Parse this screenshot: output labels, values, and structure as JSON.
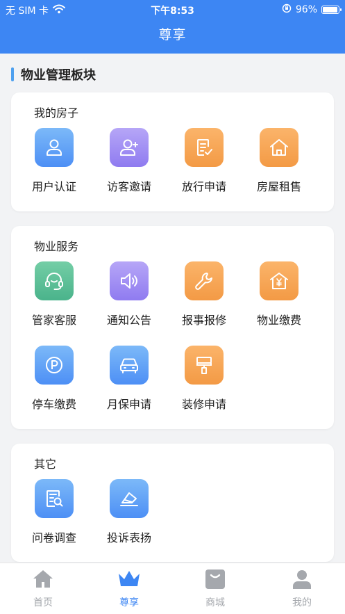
{
  "status_bar": {
    "carrier": "无 SIM 卡",
    "time": "下午8:53",
    "battery": "96%",
    "battery_level": 0.96
  },
  "nav": {
    "title": "尊享"
  },
  "section": {
    "title": "物业管理板块"
  },
  "colors": {
    "brand": "#3d86f3",
    "blue": "#4d8ff5",
    "purple": "#8f7bf0",
    "orange": "#f39a45",
    "green": "#4ab38b",
    "tab_active": "#3d86f3",
    "tab_inactive": "#a5a8ad"
  },
  "cards": [
    {
      "title": "我的房子",
      "items": [
        {
          "label": "用户认证",
          "icon": "user-icon",
          "color": "blue"
        },
        {
          "label": "访客邀请",
          "icon": "user-add-icon",
          "color": "purple"
        },
        {
          "label": "放行申请",
          "icon": "document-check-icon",
          "color": "orange"
        },
        {
          "label": "房屋租售",
          "icon": "house-icon",
          "color": "orange"
        }
      ]
    },
    {
      "title": "物业服务",
      "items": [
        {
          "label": "管家客服",
          "icon": "headset-icon",
          "color": "green"
        },
        {
          "label": "通知公告",
          "icon": "speaker-icon",
          "color": "purple"
        },
        {
          "label": "报事报修",
          "icon": "wrench-icon",
          "color": "orange"
        },
        {
          "label": "物业缴费",
          "icon": "house-yen-icon",
          "color": "orange"
        },
        {
          "label": "停车缴费",
          "icon": "parking-icon",
          "color": "blue"
        },
        {
          "label": "月保申请",
          "icon": "car-icon",
          "color": "blue"
        },
        {
          "label": "装修申请",
          "icon": "paint-brush-icon",
          "color": "orange"
        }
      ]
    },
    {
      "title": "其它",
      "items": [
        {
          "label": "问卷调查",
          "icon": "survey-icon",
          "color": "blue"
        },
        {
          "label": "投诉表扬",
          "icon": "feedback-icon",
          "color": "blue"
        }
      ]
    }
  ],
  "tabs": [
    {
      "label": "首页",
      "icon": "home-icon",
      "active": false
    },
    {
      "label": "尊享",
      "icon": "crown-icon",
      "active": true
    },
    {
      "label": "商城",
      "icon": "shopping-bag-icon",
      "active": false
    },
    {
      "label": "我的",
      "icon": "profile-icon",
      "active": false
    }
  ]
}
